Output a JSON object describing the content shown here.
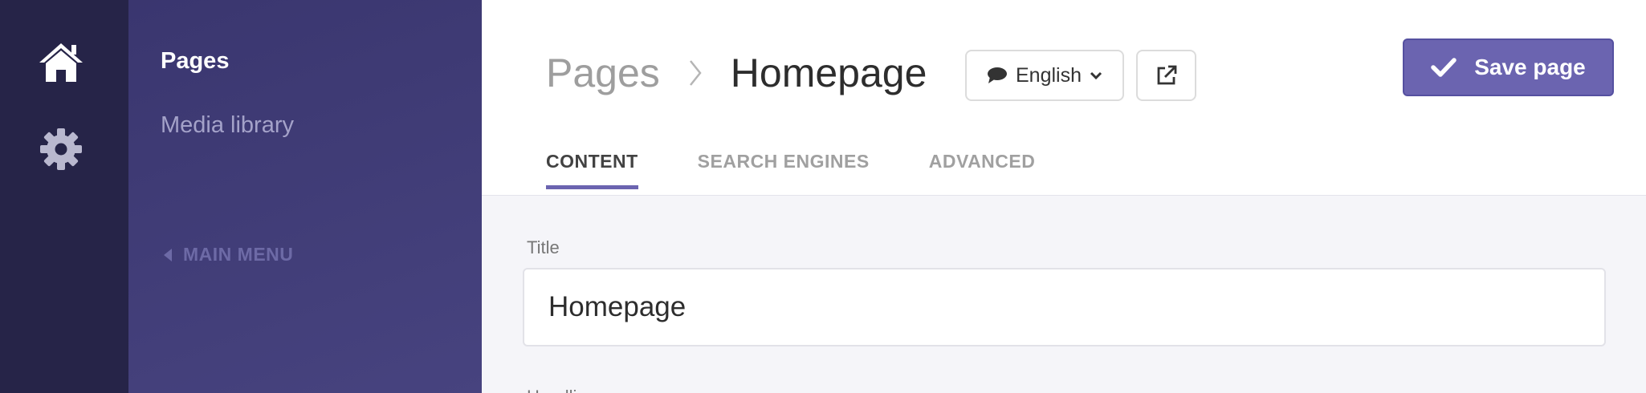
{
  "subnav": {
    "items": [
      {
        "label": "Pages"
      },
      {
        "label": "Media library"
      }
    ],
    "back_label": "MAIN MENU"
  },
  "header": {
    "breadcrumb": {
      "parent": "Pages",
      "current": "Homepage"
    },
    "language": "English",
    "save_label": "Save page"
  },
  "tabs": [
    {
      "label": "CONTENT"
    },
    {
      "label": "SEARCH ENGINES"
    },
    {
      "label": "ADVANCED"
    }
  ],
  "form": {
    "title_label": "Title",
    "title_value": "Homepage",
    "next_label": "Headline"
  },
  "icons": {
    "rail": [
      "home-icon",
      "gear-icon"
    ],
    "language": "speech-bubble-icon",
    "external": "external-link-icon",
    "save": "checkmark-icon"
  },
  "colors": {
    "accent": "#6b64b0",
    "rail_bg": "#262448",
    "subnav_bg": "#3f3b78"
  }
}
